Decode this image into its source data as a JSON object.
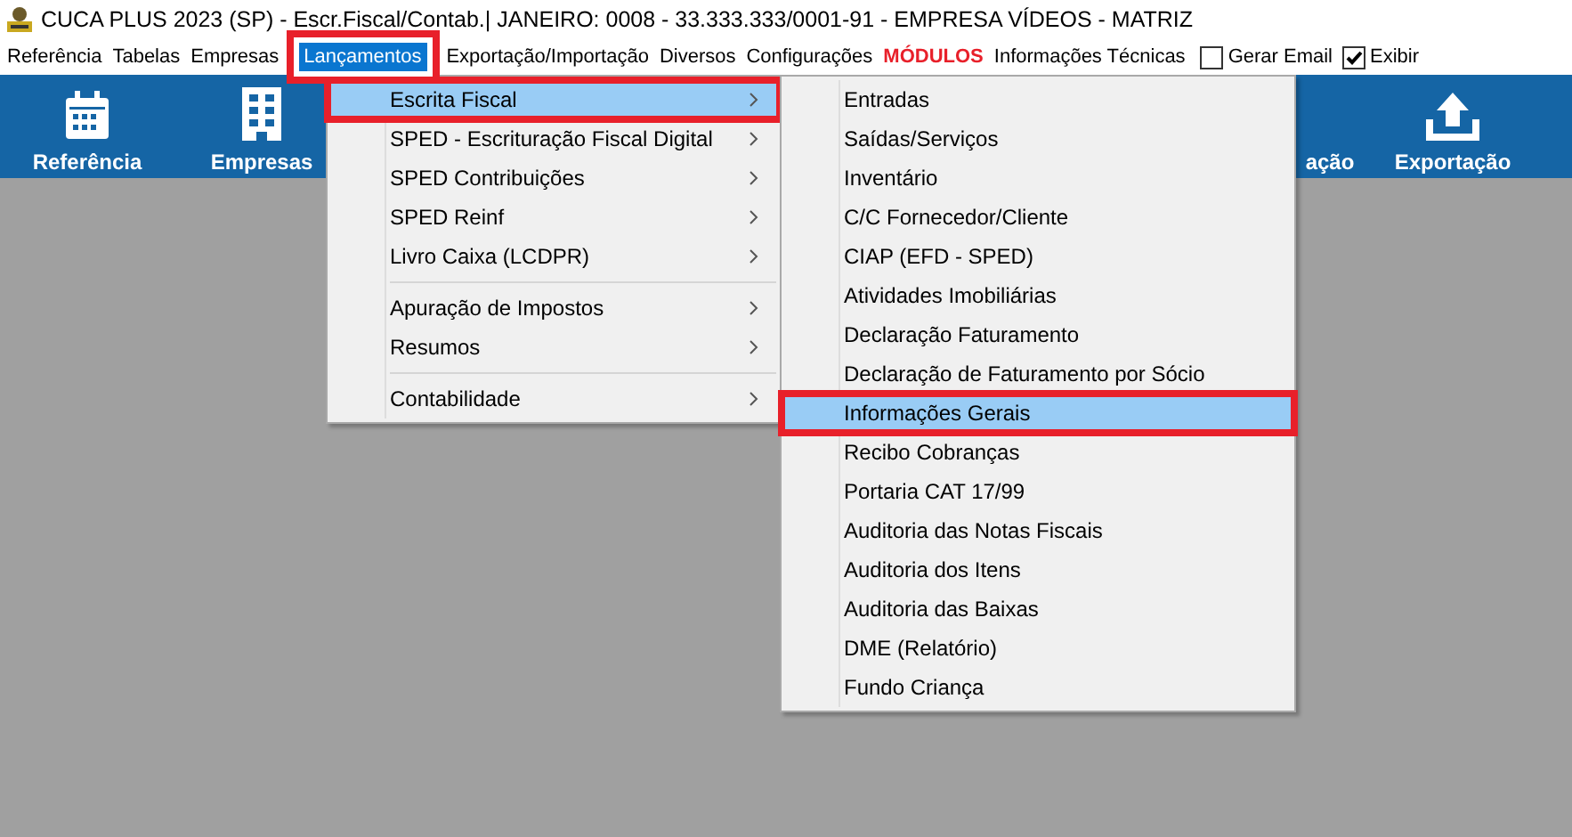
{
  "window": {
    "title": "CUCA PLUS 2023 (SP) - Escr.Fiscal/Contab.| JANEIRO: 0008 - 33.333.333/0001-91 - EMPRESA VÍDEOS - MATRIZ"
  },
  "menubar": [
    {
      "kind": "menu",
      "label": "Referência",
      "selected": false,
      "highlighted": false
    },
    {
      "kind": "menu",
      "label": "Tabelas",
      "selected": false,
      "highlighted": false
    },
    {
      "kind": "menu",
      "label": "Empresas",
      "selected": false,
      "highlighted": false
    },
    {
      "kind": "menu",
      "label": "Lançamentos",
      "selected": true,
      "highlighted": true
    },
    {
      "kind": "menu",
      "label": "Exportação/Importação",
      "selected": false,
      "highlighted": false
    },
    {
      "kind": "menu",
      "label": "Diversos",
      "selected": false,
      "highlighted": false
    },
    {
      "kind": "menu",
      "label": "Configurações",
      "selected": false,
      "highlighted": false
    },
    {
      "kind": "alert",
      "label": "MÓDULOS",
      "selected": false,
      "highlighted": false
    },
    {
      "kind": "menu",
      "label": "Informações Técnicas",
      "selected": false,
      "highlighted": false
    },
    {
      "kind": "checkbox",
      "label": "Gerar Email",
      "checked": false
    },
    {
      "kind": "checkbox",
      "label": "Exibir",
      "checked": true
    }
  ],
  "toolbar": {
    "left": [
      {
        "label": "Referência"
      },
      {
        "label": "Empresas"
      }
    ],
    "right": [
      {
        "label": "ação"
      },
      {
        "label": "Exportação"
      }
    ]
  },
  "menu": {
    "groups": [
      [
        {
          "label": "Escrita Fiscal",
          "selected": true,
          "highlighted": true
        },
        {
          "label": "SPED - Escrituração Fiscal Digital",
          "selected": false,
          "highlighted": false
        },
        {
          "label": "SPED Contribuições",
          "selected": false,
          "highlighted": false
        },
        {
          "label": "SPED Reinf",
          "selected": false,
          "highlighted": false
        },
        {
          "label": "Livro Caixa (LCDPR)",
          "selected": false,
          "highlighted": false
        }
      ],
      [
        {
          "label": "Apuração de Impostos",
          "selected": false,
          "highlighted": false
        },
        {
          "label": "Resumos",
          "selected": false,
          "highlighted": false
        }
      ],
      [
        {
          "label": "Contabilidade",
          "selected": false,
          "highlighted": false
        }
      ]
    ]
  },
  "submenu": {
    "items": [
      {
        "label": "Entradas",
        "selected": false,
        "highlighted": false
      },
      {
        "label": "Saídas/Serviços",
        "selected": false,
        "highlighted": false
      },
      {
        "label": "Inventário",
        "selected": false,
        "highlighted": false
      },
      {
        "label": "C/C Fornecedor/Cliente",
        "selected": false,
        "highlighted": false
      },
      {
        "label": "CIAP (EFD - SPED)",
        "selected": false,
        "highlighted": false
      },
      {
        "label": "Atividades Imobiliárias",
        "selected": false,
        "highlighted": false
      },
      {
        "label": "Declaração Faturamento",
        "selected": false,
        "highlighted": false
      },
      {
        "label": "Declaração de Faturamento por Sócio",
        "selected": false,
        "highlighted": false
      },
      {
        "label": "Informações Gerais",
        "selected": true,
        "highlighted": true
      },
      {
        "label": "Recibo Cobranças",
        "selected": false,
        "highlighted": false
      },
      {
        "label": "Portaria CAT 17/99",
        "selected": false,
        "highlighted": false
      },
      {
        "label": "Auditoria das Notas Fiscais",
        "selected": false,
        "highlighted": false
      },
      {
        "label": "Auditoria dos Itens",
        "selected": false,
        "highlighted": false
      },
      {
        "label": "Auditoria das Baixas",
        "selected": false,
        "highlighted": false
      },
      {
        "label": "DME (Relatório)",
        "selected": false,
        "highlighted": false
      },
      {
        "label": "Fundo Criança",
        "selected": false,
        "highlighted": false
      }
    ]
  }
}
